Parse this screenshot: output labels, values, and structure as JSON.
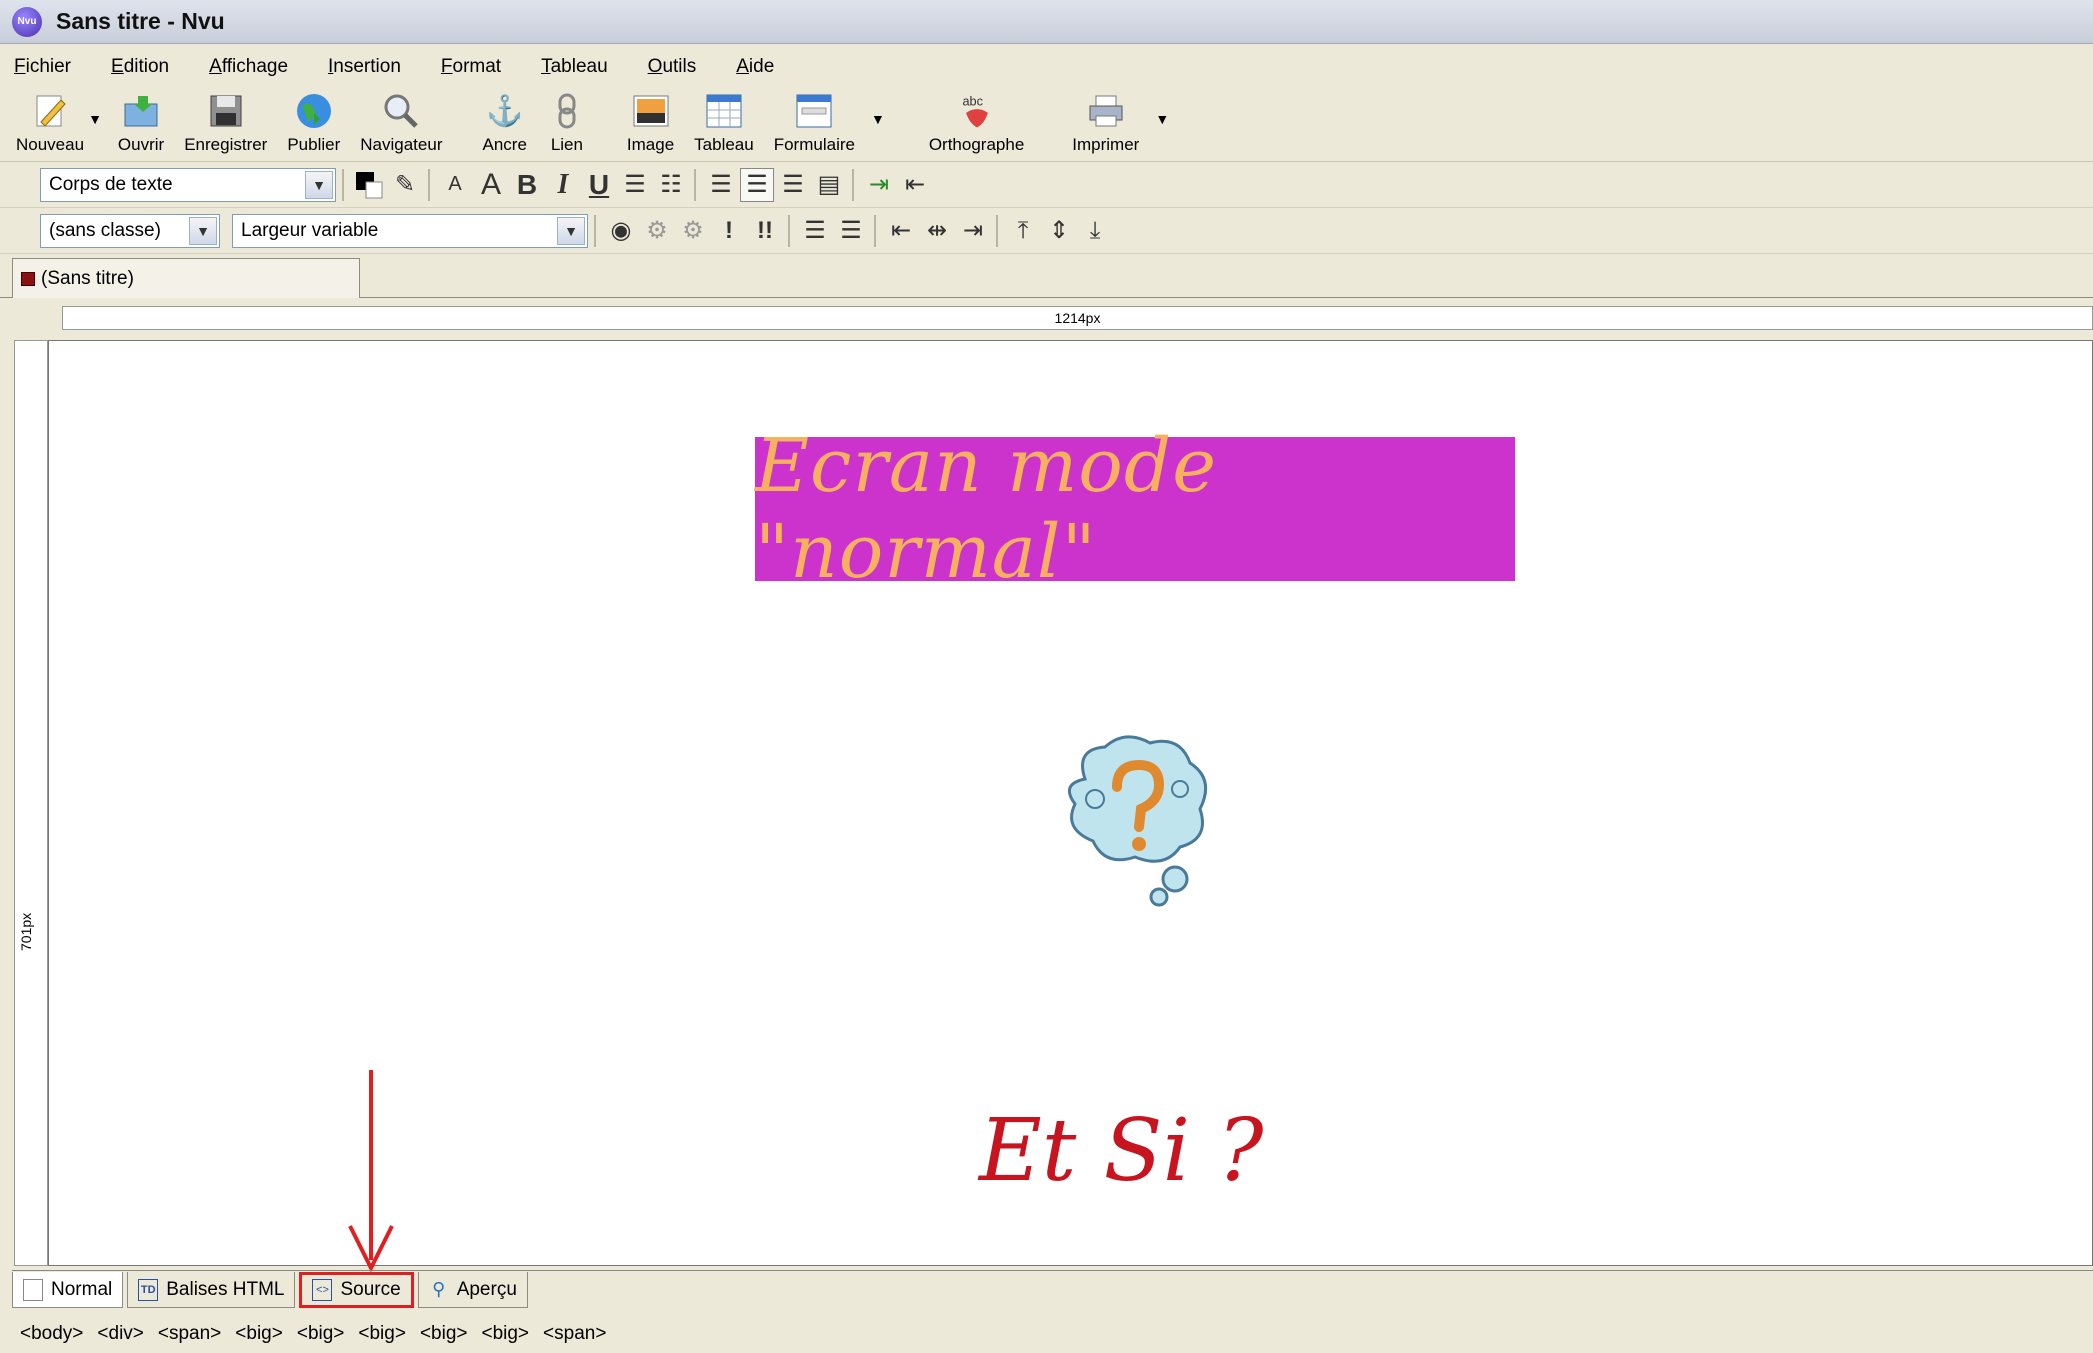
{
  "window": {
    "title": "Sans titre - Nvu",
    "logo_text": "Nvu"
  },
  "menu": [
    "Fichier",
    "Edition",
    "Affichage",
    "Insertion",
    "Format",
    "Tableau",
    "Outils",
    "Aide"
  ],
  "toolbar": {
    "nouveau": "Nouveau",
    "ouvrir": "Ouvrir",
    "enregistrer": "Enregistrer",
    "publier": "Publier",
    "navigateur": "Navigateur",
    "ancre": "Ancre",
    "lien": "Lien",
    "image": "Image",
    "tableau": "Tableau",
    "formulaire": "Formulaire",
    "orthographe": "Orthographe",
    "orthographe_badge": "abc",
    "imprimer": "Imprimer"
  },
  "format": {
    "paragraph_style": "Corps de texte",
    "class": "(sans classe)",
    "width": "Largeur variable",
    "bold": "B",
    "italic": "I",
    "underline": "U",
    "font_small": "A",
    "font_large": "A"
  },
  "document_tab": {
    "label": "(Sans titre)"
  },
  "rulers": {
    "horizontal": "1214px",
    "vertical": "701px"
  },
  "content": {
    "banner_text": "Ecran mode \"normal\"",
    "banner_bg": "#cc33cc",
    "banner_fg": "#f5b060",
    "question_text": "Et Si ?",
    "question_color": "#c8141e"
  },
  "modes": {
    "normal": "Normal",
    "balises": "Balises HTML",
    "balises_icon": "TD",
    "source": "Source",
    "apercu": "Aperçu"
  },
  "tag_path": [
    "<body>",
    "<div>",
    "<span>",
    "<big>",
    "<big>",
    "<big>",
    "<big>",
    "<big>",
    "<span>"
  ]
}
